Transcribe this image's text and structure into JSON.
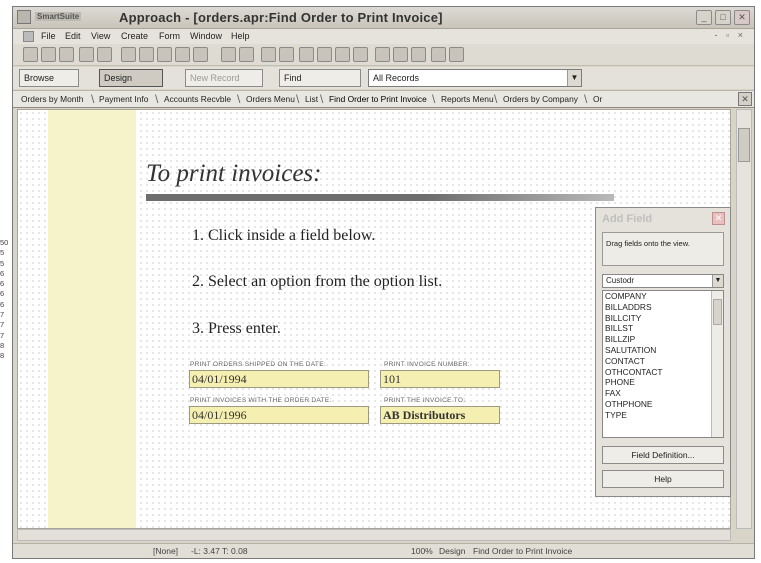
{
  "window": {
    "brand": "SmartSuite",
    "title": "Approach - [orders.apr:Find Order to Print Invoice]",
    "controls": [
      "_",
      "□",
      "✕"
    ]
  },
  "menubar": {
    "items": [
      "File",
      "Edit",
      "View",
      "Create",
      "Form",
      "Window",
      "Help"
    ],
    "mdi_controls": "- ▫ ×"
  },
  "actionbar": {
    "browse": "Browse",
    "design": "Design",
    "new_record": "New Record",
    "find": "Find",
    "records_select": "All Records"
  },
  "tabs": [
    "Orders by Month",
    "Payment Info",
    "Accounts Recvble",
    "Orders Menu",
    "List",
    "Find Order to Print Invoice",
    "Reports Menu",
    "Orders by Company",
    "Or"
  ],
  "form": {
    "heading": "To print invoices:",
    "steps": [
      "1. Click inside a field below.",
      "2. Select an option from the option list.",
      "3. Press enter."
    ],
    "fields": [
      {
        "label": "PRINT ORDERS SHIPPED ON THE DATE:",
        "value": "04/01/1994"
      },
      {
        "label": "PRINT INVOICE NUMBER:",
        "value": "101"
      },
      {
        "label": "PRINT INVOICES WITH THE ORDER DATE:",
        "value": "04/01/1996"
      },
      {
        "label": "PRINT THE INVOICE TO:",
        "value": "AB Distributors"
      }
    ]
  },
  "add_field_panel": {
    "title": "Add Field",
    "hint": "Drag fields onto the view.",
    "source": "Custodr",
    "fields": [
      "COMPANY",
      "BILLADDRS",
      "BILLCITY",
      "BILLST",
      "BILLZIP",
      "SALUTATION",
      "CONTACT",
      "OTHCONTACT",
      "PHONE",
      "FAX",
      "OTHPHONE",
      "TYPE"
    ],
    "field_definition_button": "Field Definition...",
    "help_button": "Help"
  },
  "statusbar": {
    "style": "[None]",
    "position": "-L: 3.47 T: 0.08",
    "zoom": "100%",
    "mode": "Design",
    "view": "Find Order to Print Invoice"
  },
  "left_edge_numbers": [
    "50",
    "5",
    "5",
    "6",
    "6",
    "6",
    "6",
    "7",
    "7",
    "7",
    "8",
    "8"
  ]
}
